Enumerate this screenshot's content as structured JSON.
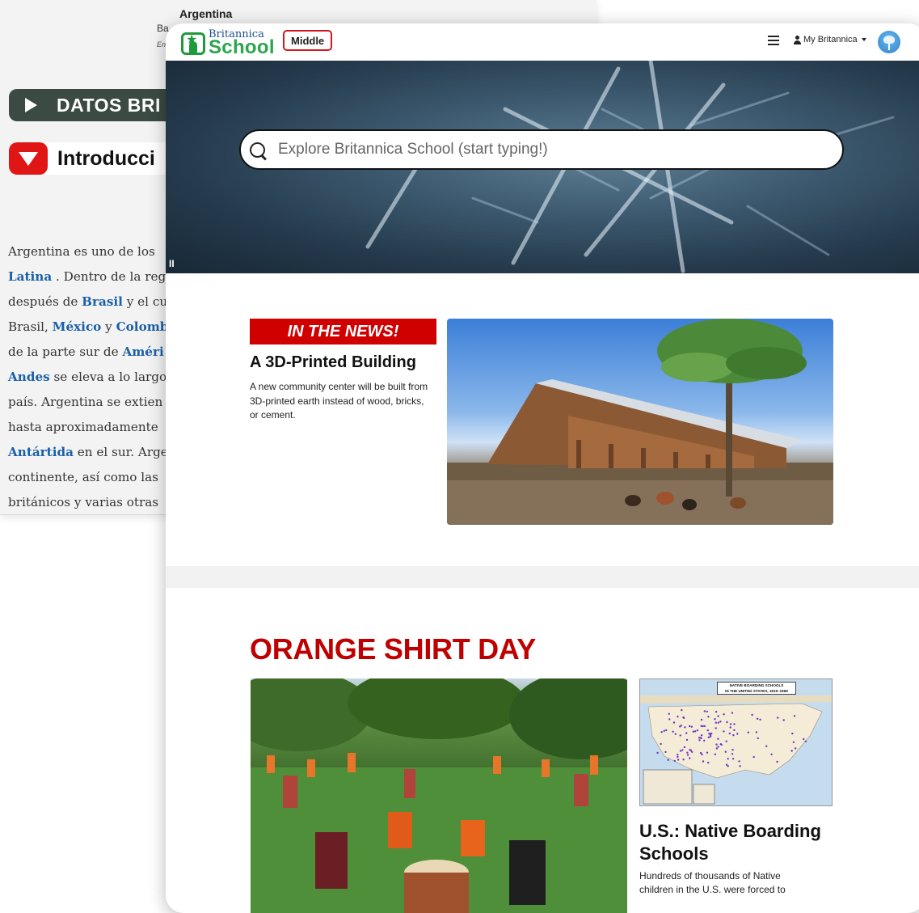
{
  "background_page": {
    "title": "Argentina",
    "subtitle": "Ba",
    "caption_fragment": "En",
    "datos_button": "DATOS BRI",
    "intro_heading": "Introducci",
    "paragraph_lines": [
      [
        {
          "t": "Argentina es uno de los",
          "link": false
        }
      ],
      [
        {
          "t": "Latina",
          "link": true
        },
        {
          "t": " . Dentro de la reg",
          "link": false
        }
      ],
      [
        {
          "t": "después de ",
          "link": false
        },
        {
          "t": "Brasil",
          "link": true
        },
        {
          "t": " y el cu",
          "link": false
        }
      ],
      [
        {
          "t": "Brasil, ",
          "link": false
        },
        {
          "t": "México",
          "link": true
        },
        {
          "t": " y ",
          "link": false
        },
        {
          "t": "Colomb",
          "link": true
        }
      ],
      [
        {
          "t": "de la parte sur de ",
          "link": false
        },
        {
          "t": "Améri",
          "link": true
        }
      ],
      [
        {
          "t": "Andes",
          "link": true
        },
        {
          "t": " se eleva a lo largo",
          "link": false
        }
      ],
      [
        {
          "t": "país. Argentina se extien",
          "link": false
        }
      ],
      [
        {
          "t": "hasta aproximadamente",
          "link": false
        }
      ],
      [
        {
          "t": "Antártida",
          "link": true
        },
        {
          "t": " en el sur. Arge",
          "link": false
        }
      ],
      [
        {
          "t": "continente, así como las",
          "link": false
        }
      ],
      [
        {
          "t": "británicos y varias otras",
          "link": false
        }
      ]
    ]
  },
  "header": {
    "logo_top": "Britannica",
    "logo_bottom": "School",
    "level": "Middle",
    "account_label": "My Britannica"
  },
  "hero": {
    "search_placeholder": "Explore Britannica School (start typing!)",
    "pause_label": "II"
  },
  "news": {
    "tag": "IN THE NEWS!",
    "title": "A 3D-Printed Building",
    "description": "A new community center will be built from 3D-printed earth instead of wood, bricks, or cement."
  },
  "feature": {
    "title": "ORANGE SHIRT DAY",
    "map_caption_title": "NATIVE BOARDING SCHOOLS",
    "map_caption_sub": "IN THE UNITED STATES, 1819–1969",
    "side_title": "U.S.: Native Boarding Schools",
    "side_description": "Hundreds of thousands of Native children in the U.S. were forced to"
  },
  "colors": {
    "accent_red": "#d00000",
    "brand_green": "#2aa64b",
    "brand_blue": "#1d4e90",
    "link_blue": "#1a5fa8"
  }
}
